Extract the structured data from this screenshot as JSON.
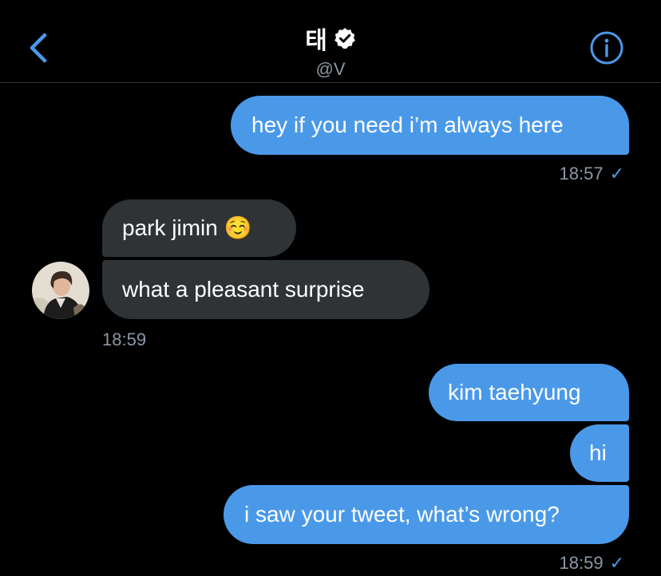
{
  "header": {
    "name": "태",
    "handle": "@V",
    "back_icon": "chevron-left-icon",
    "info_icon": "info-icon",
    "verified_icon": "verified-badge-icon"
  },
  "colors": {
    "background": "#000000",
    "accent": "#4a99e9",
    "incoming_bubble": "#2f3336",
    "muted_text": "#8b98a5"
  },
  "messages": [
    {
      "direction": "outgoing",
      "text": "hey if you need i’m always here"
    },
    {
      "direction": "incoming",
      "text": "park jimin ☺️"
    },
    {
      "direction": "incoming",
      "text": "what a pleasant surprise"
    },
    {
      "direction": "outgoing",
      "text": "kim taehyung"
    },
    {
      "direction": "outgoing",
      "text": "hi"
    },
    {
      "direction": "outgoing",
      "text": "i saw your tweet, what’s wrong?"
    }
  ],
  "timestamps": {
    "t1": "18:57",
    "t2": "18:59",
    "t3": "18:59",
    "read_mark": "✓"
  }
}
